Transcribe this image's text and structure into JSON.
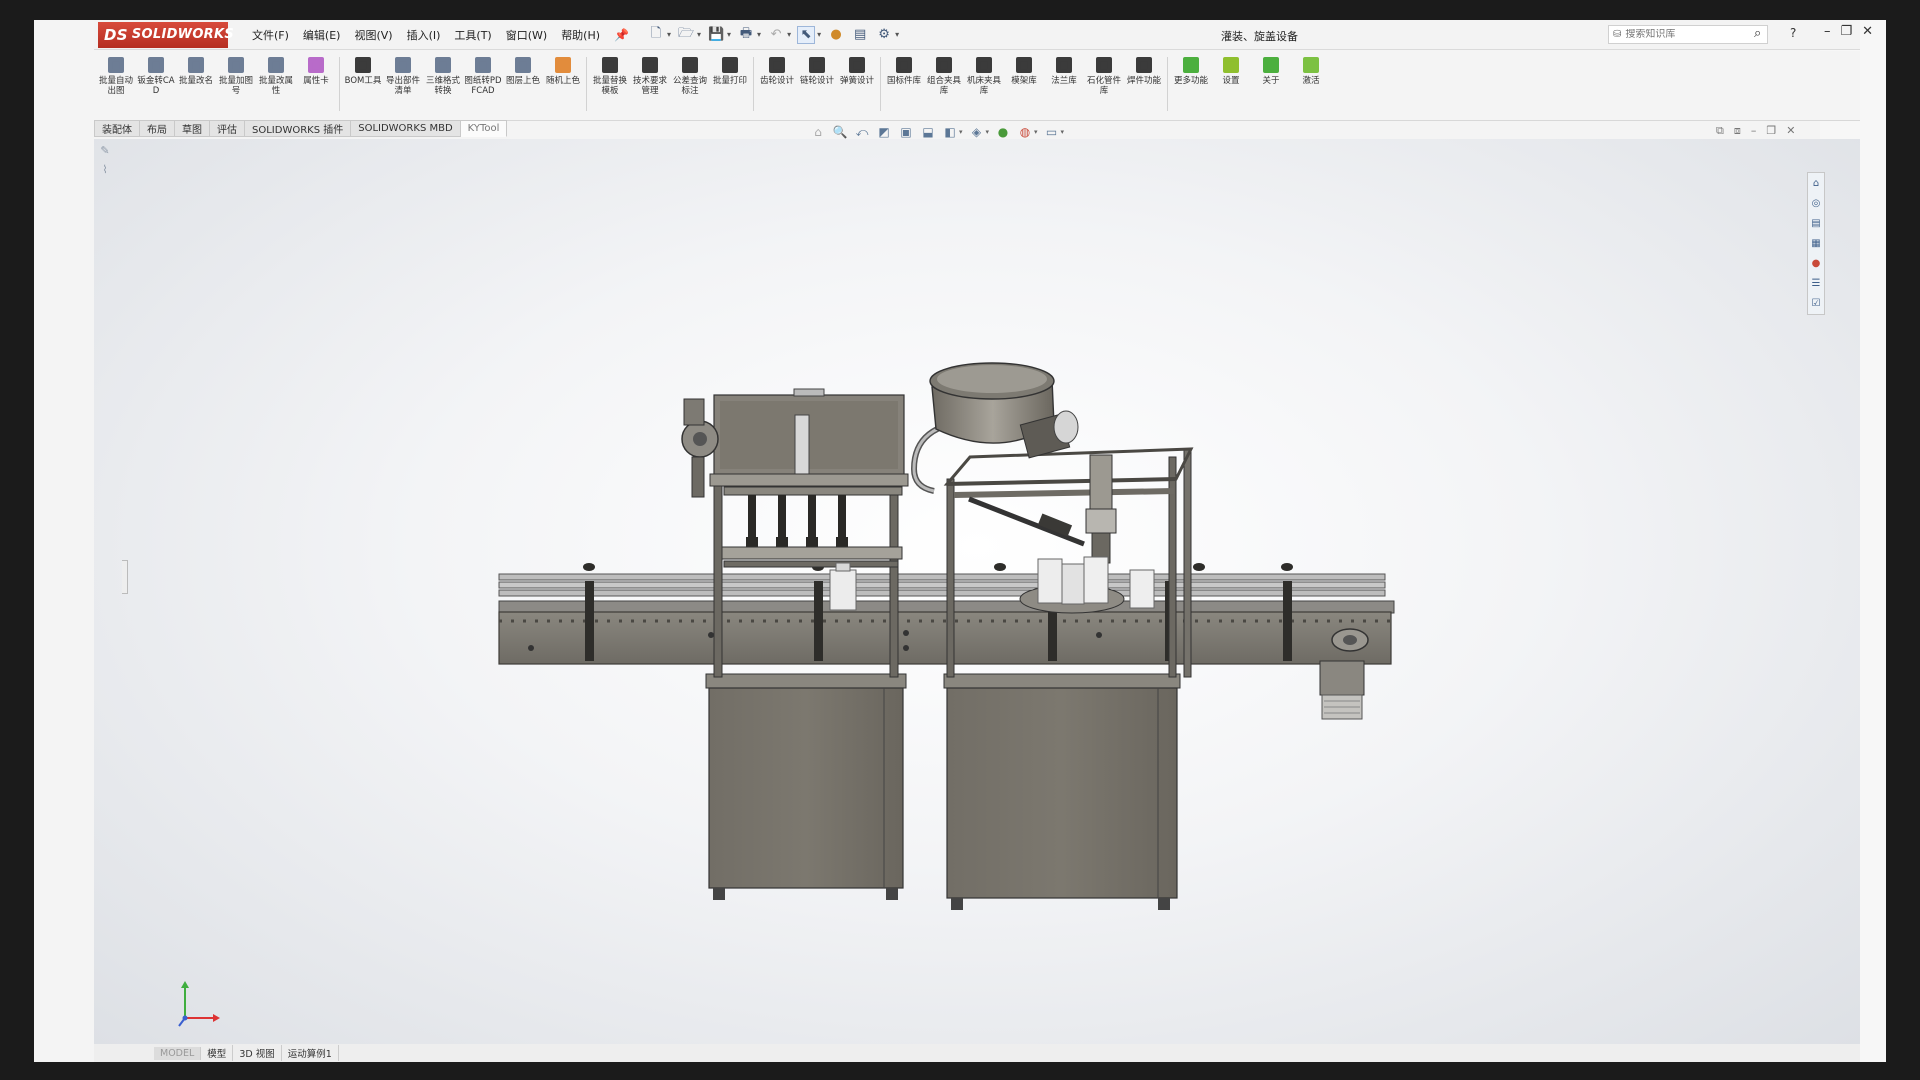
{
  "app": {
    "logo_text": "SOLIDWORKS",
    "logo_ds": "DS",
    "document_title": "灌装、旋盖设备",
    "menus": [
      "文件(F)",
      "编辑(E)",
      "视图(V)",
      "插入(I)",
      "工具(T)",
      "窗口(W)",
      "帮助(H)"
    ]
  },
  "search": {
    "placeholder": "搜索知识库"
  },
  "ribbon": {
    "groups": [
      [
        {
          "label": "批量自动出图",
          "icon": "batch-drawing-icon",
          "color": "#6d7d95"
        },
        {
          "label": "钣金转CAD",
          "icon": "sheetmetal-cad-icon",
          "color": "#6d7d95"
        },
        {
          "label": "批量改名",
          "icon": "batch-rename-icon",
          "color": "#6d7d95"
        },
        {
          "label": "批量加图号",
          "icon": "batch-number-icon",
          "color": "#6d7d95"
        },
        {
          "label": "批量改属性",
          "icon": "batch-property-icon",
          "color": "#6d7d95"
        },
        {
          "label": "属性卡",
          "icon": "property-card-icon",
          "color": "#b86bc9"
        }
      ],
      [
        {
          "label": "BOM工具",
          "icon": "bom-icon",
          "color": "#3b3b3b"
        },
        {
          "label": "导出部件清单",
          "icon": "export-list-icon",
          "color": "#6d7d95"
        },
        {
          "label": "三维格式转换",
          "icon": "format-convert-icon",
          "color": "#6d7d95"
        },
        {
          "label": "图纸转PDFCAD",
          "icon": "pdf-convert-icon",
          "color": "#6d7d95"
        },
        {
          "label": "图层上色",
          "icon": "layer-color-icon",
          "color": "#6d7d95"
        },
        {
          "label": "随机上色",
          "icon": "random-color-icon",
          "color": "#e28c3c"
        }
      ],
      [
        {
          "label": "批量替换模板",
          "icon": "replace-template-icon",
          "color": "#3b3b3b"
        },
        {
          "label": "技术要求管理",
          "icon": "tech-req-icon",
          "color": "#3b3b3b"
        },
        {
          "label": "公差查询标注",
          "icon": "tolerance-icon",
          "color": "#3b3b3b"
        },
        {
          "label": "批量打印",
          "icon": "batch-print-icon",
          "color": "#3b3b3b"
        }
      ],
      [
        {
          "label": "齿轮设计",
          "icon": "gear-design-icon",
          "color": "#3b3b3b"
        },
        {
          "label": "链轮设计",
          "icon": "sprocket-icon",
          "color": "#3b3b3b"
        },
        {
          "label": "弹簧设计",
          "icon": "spring-icon",
          "color": "#3b3b3b"
        }
      ],
      [
        {
          "label": "国标件库",
          "icon": "gb-library-icon",
          "color": "#3b3b3b"
        },
        {
          "label": "组合夹具库",
          "icon": "fixture-icon",
          "color": "#3b3b3b"
        },
        {
          "label": "机床夹具库",
          "icon": "machine-fixture-icon",
          "color": "#3b3b3b"
        },
        {
          "label": "模架库",
          "icon": "mold-base-icon",
          "color": "#3b3b3b"
        },
        {
          "label": "法兰库",
          "icon": "flange-icon",
          "color": "#3b3b3b"
        },
        {
          "label": "石化管件库",
          "icon": "pipe-fitting-icon",
          "color": "#3b3b3b"
        },
        {
          "label": "焊件功能",
          "icon": "weldment-icon",
          "color": "#3b3b3b"
        }
      ],
      [
        {
          "label": "更多功能",
          "icon": "more-functions-icon",
          "color": "#4caf3e"
        },
        {
          "label": "设置",
          "icon": "settings-icon",
          "color": "#8fbf2e"
        },
        {
          "label": "关于",
          "icon": "about-icon",
          "color": "#4caf3e"
        },
        {
          "label": "激活",
          "icon": "activate-icon",
          "color": "#7cc142"
        }
      ]
    ]
  },
  "tabs": [
    "装配体",
    "布局",
    "草图",
    "评估",
    "SOLIDWORKS 插件",
    "SOLIDWORKS MBD",
    "KYTool"
  ],
  "active_tab": "KYTool",
  "bottom_tabs": [
    "MODEL",
    "模型",
    "3D 视图",
    "运动算例1"
  ],
  "triad": {
    "x_label": "",
    "y_label": ""
  }
}
